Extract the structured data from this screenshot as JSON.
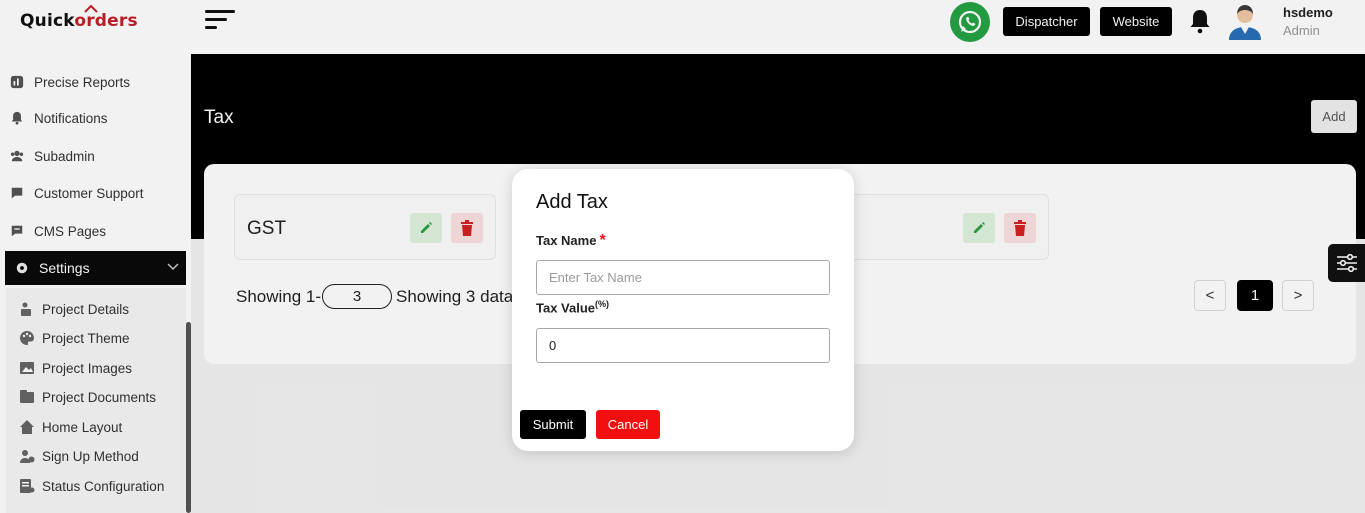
{
  "brand": {
    "logo_part1": "Quick",
    "logo_part2": "orders",
    "accent": "#c2202a"
  },
  "sidebar": {
    "items": [
      {
        "label": "Precise Reports",
        "icon": "reports-icon"
      },
      {
        "label": "Notifications",
        "icon": "bell-icon"
      },
      {
        "label": "Subadmin",
        "icon": "users-icon"
      },
      {
        "label": "Customer Support",
        "icon": "chat-icon"
      },
      {
        "label": "CMS Pages",
        "icon": "pages-icon"
      }
    ],
    "settings": {
      "label": "Settings",
      "icon": "gear-icon",
      "expanded": true
    },
    "sub_items": [
      {
        "label": "Project Details",
        "icon": "project-details-icon"
      },
      {
        "label": "Project Theme",
        "icon": "palette-icon"
      },
      {
        "label": "Project Images",
        "icon": "image-icon"
      },
      {
        "label": "Project Documents",
        "icon": "documents-icon"
      },
      {
        "label": "Home Layout",
        "icon": "home-icon"
      },
      {
        "label": "Sign Up Method",
        "icon": "signup-icon"
      },
      {
        "label": "Status Configuration",
        "icon": "status-config-icon"
      }
    ]
  },
  "topbar": {
    "dispatcher_label": "Dispatcher",
    "website_label": "Website",
    "user": {
      "name": "hsdemo",
      "role": "Admin"
    }
  },
  "page": {
    "title": "Tax",
    "add_label": "Add",
    "taxes": [
      {
        "name": "GST"
      }
    ],
    "pagination": {
      "showing_prefix": "Showing 1-",
      "page_size": "3",
      "showing_suffix": "Showing 3 data",
      "prev": "<",
      "current": "1",
      "next": ">"
    }
  },
  "modal": {
    "title": "Add Tax",
    "tax_name_label": "Tax Name",
    "required_mark": "*",
    "tax_name_placeholder": "Enter Tax Name",
    "tax_name_value": "",
    "tax_value_label": "Tax Value",
    "tax_value_unit": "(%)",
    "tax_value": "0",
    "submit_label": "Submit",
    "cancel_label": "Cancel"
  },
  "colors": {
    "primary": "#000000",
    "danger": "#f20f0f",
    "whatsapp": "#25a244"
  }
}
